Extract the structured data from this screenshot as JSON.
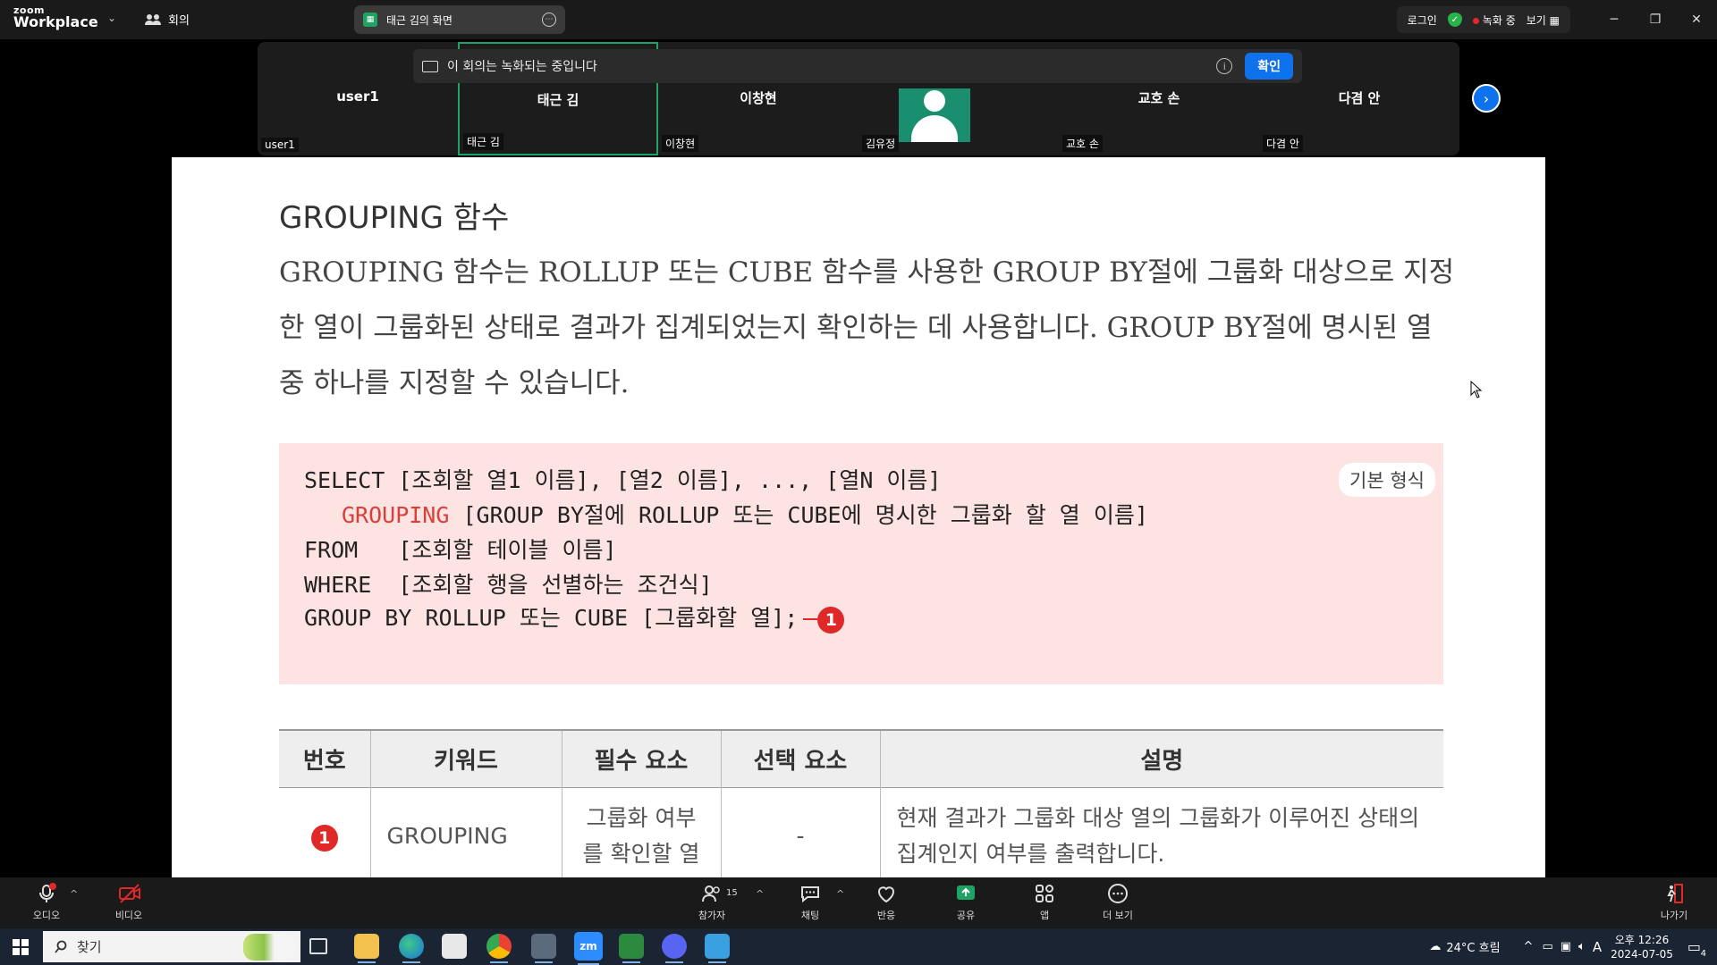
{
  "app": {
    "logo_line1": "zoom",
    "logo_line2": "Workplace",
    "meeting_label": "회의",
    "share_title": "태근 김의 화면",
    "login_label": "로그인",
    "recording_label": "녹화 중",
    "view_label": "보기"
  },
  "banner": {
    "text": "이 회의는 녹화되는 중입니다",
    "confirm_label": "확인"
  },
  "participants": [
    {
      "top": "user1",
      "bottom": "user1"
    },
    {
      "top": "태근 김",
      "bottom": "태근 김"
    },
    {
      "top": "이창현",
      "bottom": "이창현"
    },
    {
      "top": "",
      "bottom": "김유정"
    },
    {
      "top": "교호 손",
      "bottom": "교호 손"
    },
    {
      "top": "다겸 안",
      "bottom": "다겸 안"
    }
  ],
  "slide": {
    "title": "GROUPING 함수",
    "description": "GROUPING 함수는 ROLLUP 또는 CUBE 함수를 사용한 GROUP BY절에 그룹화 대상으로 지정한 열이 그룹화된 상태로 결과가 집계되었는지 확인하는 데 사용합니다. GROUP BY절에 명시된 열 중 하나를 지정할 수 있습니다.",
    "syntax": {
      "badge": "기본 형식",
      "line1": "SELECT [조회할 열1 이름], [열2 이름], ..., [열N 이름]",
      "line2_kw": "GROUPING",
      "line2_rest": " [GROUP BY절에 ROLLUP 또는 CUBE에 명시한 그룹화 할 열 이름]",
      "line3": "FROM   [조회할 테이블 이름]",
      "line4": "WHERE  [조회할 행을 선별하는 조건식]",
      "line5": "GROUP BY ROLLUP 또는 CUBE [그룹화할 열];",
      "marker": "1"
    },
    "table": {
      "headers": [
        "번호",
        "키워드",
        "필수 요소",
        "선택 요소",
        "설명"
      ],
      "row": {
        "number": "1",
        "keyword": "GROUPING",
        "required": "그룹화 여부를 확인할 열",
        "optional": "-",
        "description": "현재 결과가 그룹화 대상 열의 그룹화가 이루어진 상태의 집계인지 여부를 출력합니다."
      }
    }
  },
  "toolbar": {
    "audio": "오디오",
    "video": "비디오",
    "participants": "참가자",
    "participant_count": "15",
    "chat": "채팅",
    "reactions": "반응",
    "share": "공유",
    "apps": "앱",
    "more": "더 보기",
    "leave": "나가기"
  },
  "taskbar": {
    "search_placeholder": "찾기",
    "weather": "24°C 흐림",
    "time": "오후 12:26",
    "date": "2024-07-05",
    "ime": "A",
    "notification_count": "4"
  },
  "colors": {
    "zoom_blue": "#0e72ed",
    "active_green": "#1ea362",
    "syntax_bg": "#fde3e1",
    "accent_red": "#e02828"
  }
}
